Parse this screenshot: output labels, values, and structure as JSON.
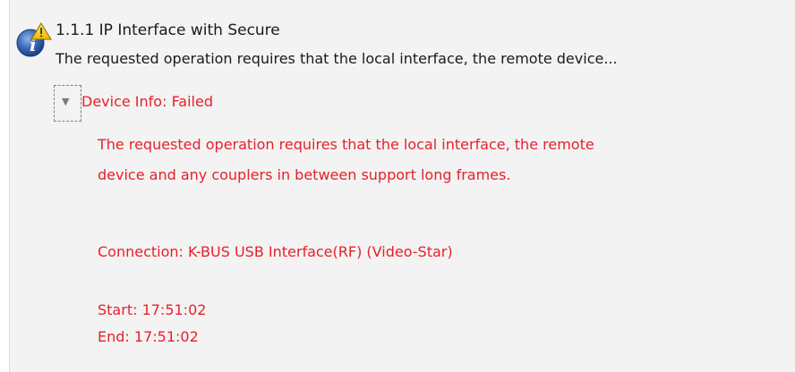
{
  "entry": {
    "title": "1.1.1 IP Interface with Secure",
    "summary": "The requested operation requires that the local interface, the remote device...",
    "icon": "info-warning-icon"
  },
  "node": {
    "expander_glyph": "▼",
    "label": "Device Info: Failed",
    "message_line1": "The requested operation requires that the local interface, the remote",
    "message_line2": "device and any couplers in between support long frames.",
    "connection": "Connection: K-BUS USB Interface(RF) (Video-Star)",
    "start": "Start: 17:51:02",
    "end": "End: 17:51:02"
  },
  "colors": {
    "error_red": "#e8202a",
    "panel_bg": "#f3f3f3",
    "text": "#1a1a1a"
  }
}
